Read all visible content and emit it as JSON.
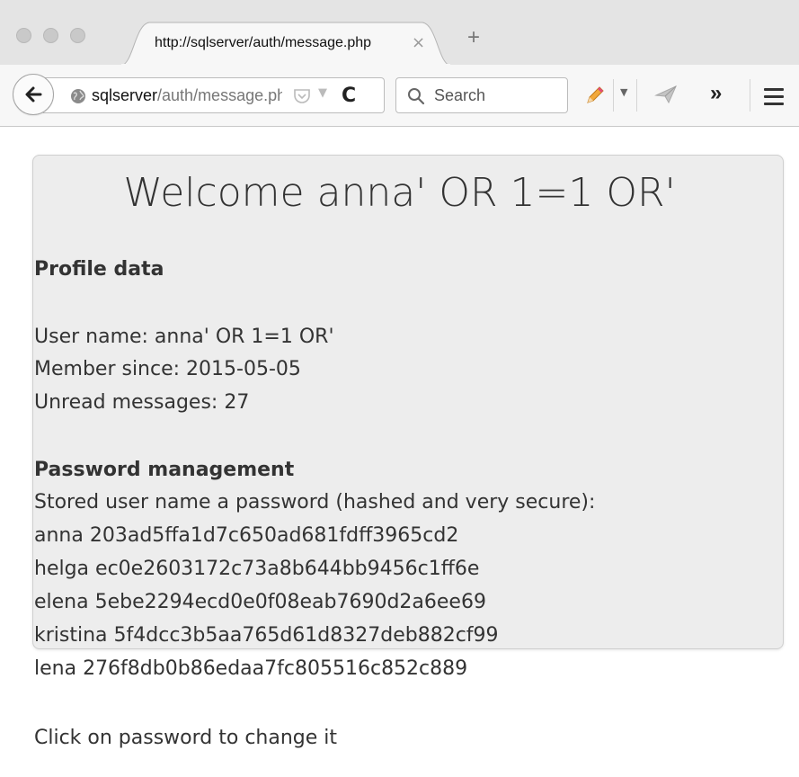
{
  "browser": {
    "tab_title": "http://sqlserver/auth/message.php",
    "tab_close": "×",
    "new_tab": "+",
    "url_host": "sqlserver",
    "url_path": "/auth/message.php",
    "reload": "C",
    "search_placeholder": "Search",
    "overflow": "»",
    "icons": {
      "traffic_lights": "window-control-icon",
      "back": "back-arrow-icon",
      "site": "globe-icon",
      "pocket": "pocket-icon",
      "dropdown": "chevron-down-icon",
      "search": "search-icon",
      "pencil": "pencil-icon",
      "send": "send-icon",
      "menu": "hamburger-menu-icon"
    }
  },
  "page": {
    "welcome": "Welcome anna' OR 1=1 OR'",
    "profile_heading": "Profile data",
    "user_name": "User name: anna' OR 1=1 OR'",
    "member_since": "Member since: 2015-05-05",
    "unread": "Unread messages: 27",
    "password_heading": "Password management",
    "stored_intro": "Stored user name a password (hashed and very secure):",
    "users": [
      "anna 203ad5ffa1d7c650ad681fdff3965cd2",
      "helga ec0e2603172c73a8b644bb9456c1ff6e",
      "elena 5ebe2294ecd0e0f08eab7690d2a6ee69",
      "kristina 5f4dcc3b5aa765d61d8327deb882cf99",
      "lena 276f8db0b86edaa7fc805516c852c889"
    ],
    "click_hint": "Click on password to change it"
  }
}
